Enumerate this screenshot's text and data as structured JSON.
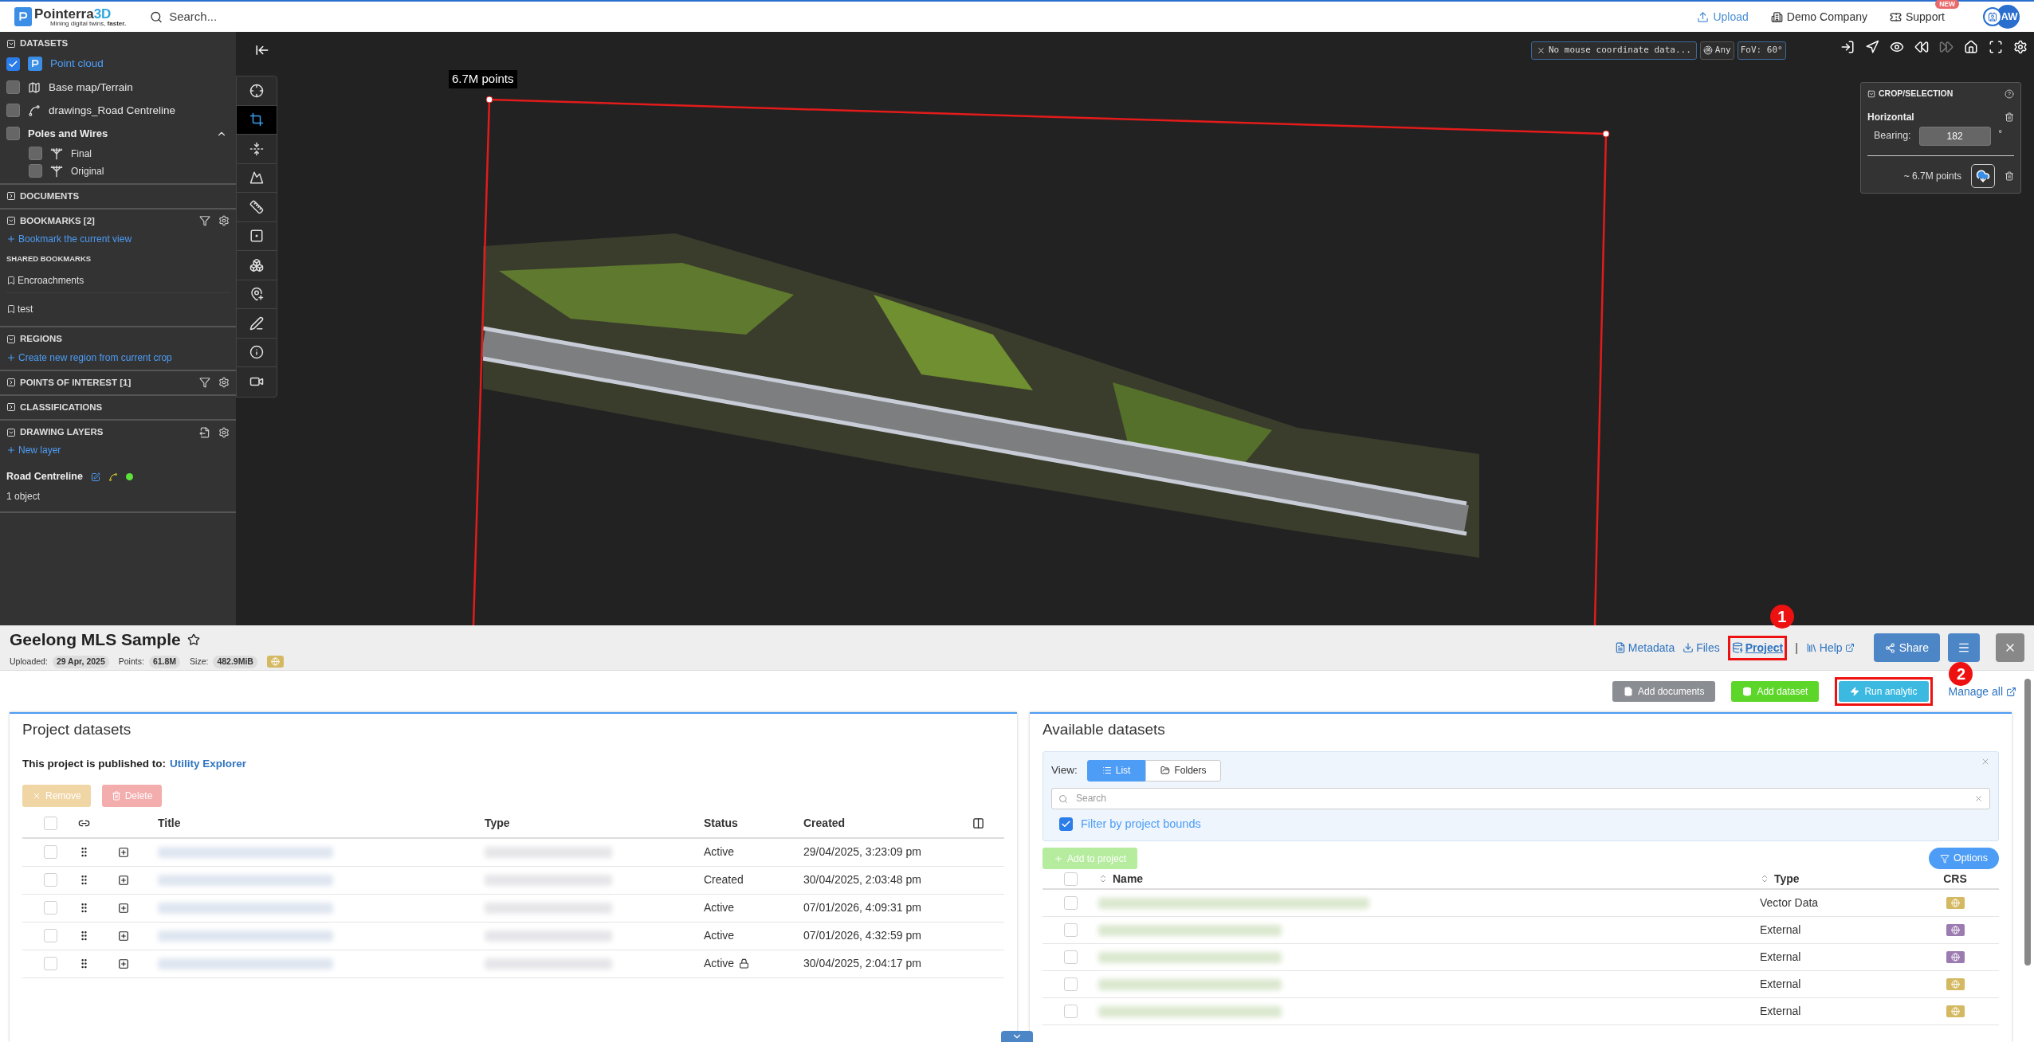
{
  "topbar": {
    "brand": "Pointerra",
    "brand_suffix": "3D",
    "tagline": "Mining digital twins, **faster.**",
    "search_placeholder": "Search...",
    "links": [
      {
        "kind": "upload",
        "label": "Upload"
      },
      {
        "kind": "company",
        "label": "Demo Company"
      },
      {
        "kind": "support",
        "label": "Support",
        "badge": "NEW"
      }
    ],
    "avatar": "AW"
  },
  "sidebar": {
    "sections": [
      {
        "kind": "datasets",
        "title": "DATASETS",
        "expanded": true,
        "items": [
          {
            "kind": "pointcloud",
            "label": "Point cloud",
            "checked": true
          },
          {
            "kind": "map",
            "label": "Base map/Terrain",
            "checked": false
          },
          {
            "kind": "drawing",
            "label": "drawings_Road Centreline",
            "checked": false
          },
          {
            "kind": "group",
            "label": "Poles and Wires",
            "checked": false,
            "expanded": true,
            "children": [
              {
                "kind": "pole",
                "label": "Final",
                "checked": false
              },
              {
                "kind": "pole",
                "label": "Original",
                "checked": false
              }
            ]
          }
        ]
      },
      {
        "kind": "plain",
        "title": "DOCUMENTS",
        "expanded": false
      },
      {
        "kind": "bookmarks",
        "title": "BOOKMARKS [2]",
        "expanded": true,
        "add_link": "Bookmark the current view",
        "subheading": "SHARED BOOKMARKS",
        "bookmarks": [
          "Encroachments",
          "test"
        ]
      },
      {
        "kind": "plain",
        "title": "REGIONS",
        "expanded": true,
        "add_link": "Create new region from current crop"
      },
      {
        "kind": "bookmarks",
        "title": "POINTS OF INTEREST [1]",
        "expanded": false
      },
      {
        "kind": "plain",
        "title": "CLASSIFICATIONS",
        "expanded": false
      },
      {
        "kind": "layers",
        "title": "DRAWING LAYERS",
        "expanded": true,
        "add_link": "New layer",
        "layers": [
          {
            "name": "Road Centreline",
            "color": "#5be33a",
            "count": "1 object"
          }
        ]
      }
    ]
  },
  "tools": [
    {
      "kind": "locate",
      "selected": false
    },
    {
      "kind": "crop",
      "selected": true
    },
    {
      "kind": "section",
      "selected": false
    },
    {
      "kind": "terrain",
      "selected": false
    },
    {
      "kind": "measure",
      "selected": false
    },
    {
      "kind": "frame",
      "selected": false
    },
    {
      "kind": "objects",
      "selected": false
    },
    {
      "kind": "poi",
      "selected": false
    },
    {
      "kind": "draw",
      "selected": false
    },
    {
      "kind": "info",
      "selected": false
    },
    {
      "kind": "video",
      "selected": false
    }
  ],
  "viewer": {
    "points_label": "6.7M points",
    "coordinate_text": "No mouse coordinate data...",
    "snap": "Any",
    "fov": "FoV: 60°",
    "controls": [
      {
        "kind": "enter",
        "disabled": false
      },
      {
        "kind": "navigate",
        "disabled": false
      },
      {
        "kind": "eye",
        "disabled": false
      },
      {
        "kind": "back",
        "disabled": false
      },
      {
        "kind": "forward",
        "disabled": true
      },
      {
        "kind": "home",
        "disabled": false
      },
      {
        "kind": "fullscreen",
        "disabled": false
      },
      {
        "kind": "settings",
        "disabled": false
      }
    ],
    "crop_panel": {
      "title": "CROP/SELECTION",
      "mode": "Horizontal",
      "bearing_label": "Bearing:",
      "bearing": "182",
      "unit": "°",
      "points": "~ 6.7M points"
    }
  },
  "project": {
    "title": "Geelong MLS Sample",
    "meta": [
      {
        "label": "Uploaded:",
        "value": "29 Apr, 2025"
      },
      {
        "label": "Points:",
        "value": "61.8M"
      },
      {
        "label": "Size:",
        "value": "482.9MiB"
      }
    ],
    "nav": [
      {
        "kind": "metadata",
        "label": "Metadata",
        "selected": false
      },
      {
        "kind": "files",
        "label": "Files",
        "selected": false
      },
      {
        "kind": "project",
        "label": "Project",
        "selected": true,
        "annotation": "1"
      },
      {
        "kind": "help",
        "label": "Help",
        "selected": false
      }
    ],
    "separator": "|",
    "share": "Share",
    "actions": [
      {
        "kind": "documents",
        "label": "Add documents"
      },
      {
        "kind": "dataset",
        "label": "Add dataset"
      },
      {
        "kind": "analytic",
        "label": "Run analytic",
        "annotation": "2"
      }
    ],
    "manage_all": "Manage all"
  },
  "project_datasets": {
    "title": "Project datasets",
    "published_prefix": "This project is published to:",
    "published_target": "Utility Explorer",
    "buttons": [
      {
        "kind": "remove",
        "label": "Remove",
        "disabled": true
      },
      {
        "kind": "delete",
        "label": "Delete",
        "disabled": true
      }
    ],
    "columns": [
      "Title",
      "Type",
      "Status",
      "Created"
    ],
    "all_checked": false,
    "rows": [
      {
        "checked": false,
        "status": "Active",
        "created": "29/04/2025, 3:23:09 pm",
        "locked": false
      },
      {
        "checked": false,
        "status": "Created",
        "created": "30/04/2025, 2:03:48 pm",
        "locked": false
      },
      {
        "checked": false,
        "status": "Active",
        "created": "07/01/2026, 4:09:31 pm",
        "locked": false
      },
      {
        "checked": false,
        "status": "Active",
        "created": "07/01/2026, 4:32:59 pm",
        "locked": false
      },
      {
        "checked": false,
        "status": "Active",
        "created": "30/04/2025, 2:04:17 pm",
        "locked": true
      }
    ]
  },
  "available_datasets": {
    "title": "Available datasets",
    "view_label": "View:",
    "views": [
      {
        "kind": "list",
        "label": "List",
        "selected": true
      },
      {
        "kind": "folders",
        "label": "Folders",
        "selected": false
      }
    ],
    "search_placeholder": "Search",
    "filter": {
      "label": "Filter by project bounds",
      "checked": true
    },
    "add_button": {
      "label": "Add to project",
      "disabled": true
    },
    "options": "Options",
    "columns": [
      "Name",
      "Type",
      "CRS"
    ],
    "all_checked": false,
    "rows": [
      {
        "checked": false,
        "type": "Vector Data",
        "color": "#d4b862"
      },
      {
        "checked": false,
        "type": "External",
        "color": "#9b7bb0"
      },
      {
        "checked": false,
        "type": "External",
        "color": "#9b7bb0"
      },
      {
        "checked": false,
        "type": "External",
        "color": "#d4b862"
      },
      {
        "checked": false,
        "type": "External",
        "color": "#d4b862"
      }
    ]
  }
}
